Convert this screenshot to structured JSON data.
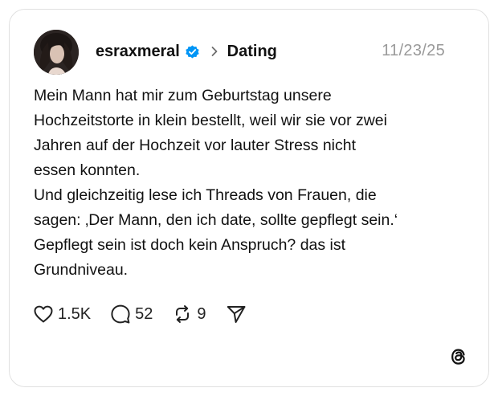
{
  "post": {
    "username": "esraxmeral",
    "topic": "Dating",
    "timestamp": "11/23/25",
    "text": "Mein Mann hat mir zum Geburtstag unsere\nHochzeitstorte in klein bestellt, weil wir sie vor zwei\nJahren auf der Hochzeit vor lauter Stress nicht\nessen konnten.\nUnd gleichzeitig lese ich Threads von Frauen, die\nsagen: ‚Der Mann, den ich date, sollte gepflegt sein.‘\nGepflegt sein ist doch kein Anspruch? das ist\nGrundniveau.",
    "verified": true
  },
  "actions": {
    "likes": "1.5K",
    "replies": "52",
    "reposts": "9"
  },
  "icons": {
    "verified": "verified-badge-icon",
    "chevron": "chevron-right-icon",
    "like": "heart-icon",
    "reply": "comment-icon",
    "repost": "repost-icon",
    "share": "send-icon",
    "brand": "threads-logo-icon"
  },
  "colors": {
    "verified_blue": "#0095f6",
    "timestamp_gray": "#9a9a9a",
    "text": "#111111",
    "card_border": "#e1e1e1"
  }
}
